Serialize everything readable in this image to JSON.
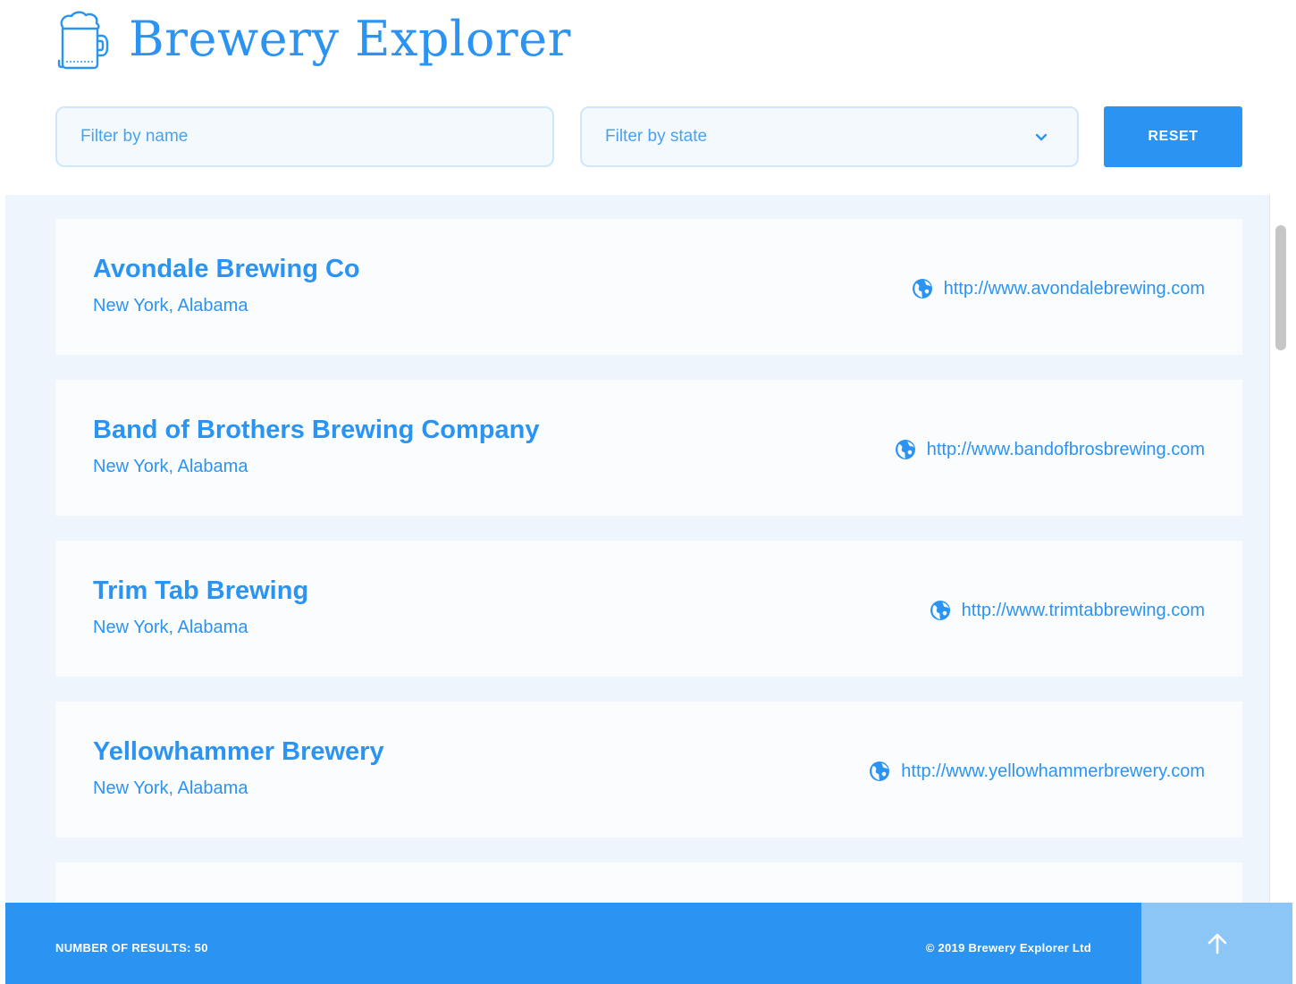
{
  "header": {
    "title": "Brewery Explorer",
    "logo_icon": "beer-mug-icon"
  },
  "filters": {
    "name_placeholder": "Filter by name",
    "state_placeholder": "Filter by state",
    "reset_label": "RESET"
  },
  "breweries": [
    {
      "name": "Avondale Brewing Co",
      "location": "New York, Alabama",
      "url": "http://www.avondalebrewing.com"
    },
    {
      "name": "Band of Brothers Brewing Company",
      "location": "New York, Alabama",
      "url": "http://www.bandofbrosbrewing.com"
    },
    {
      "name": "Trim Tab Brewing",
      "location": "New York, Alabama",
      "url": "http://www.trimtabbrewing.com"
    },
    {
      "name": "Yellowhammer Brewery",
      "location": "New York, Alabama",
      "url": "http://www.yellowhammerbrewery.com"
    }
  ],
  "footer": {
    "results_label": "NUMBER OF RESULTS: 50",
    "copyright": "© 2019  Brewery Explorer Ltd",
    "scroll_top_icon": "arrow-up-icon"
  },
  "colors": {
    "accent": "#2b94f2",
    "list_background": "#eef5fc",
    "card_background": "#fbfcfe",
    "scroll_top_background": "#8cc6f6"
  }
}
